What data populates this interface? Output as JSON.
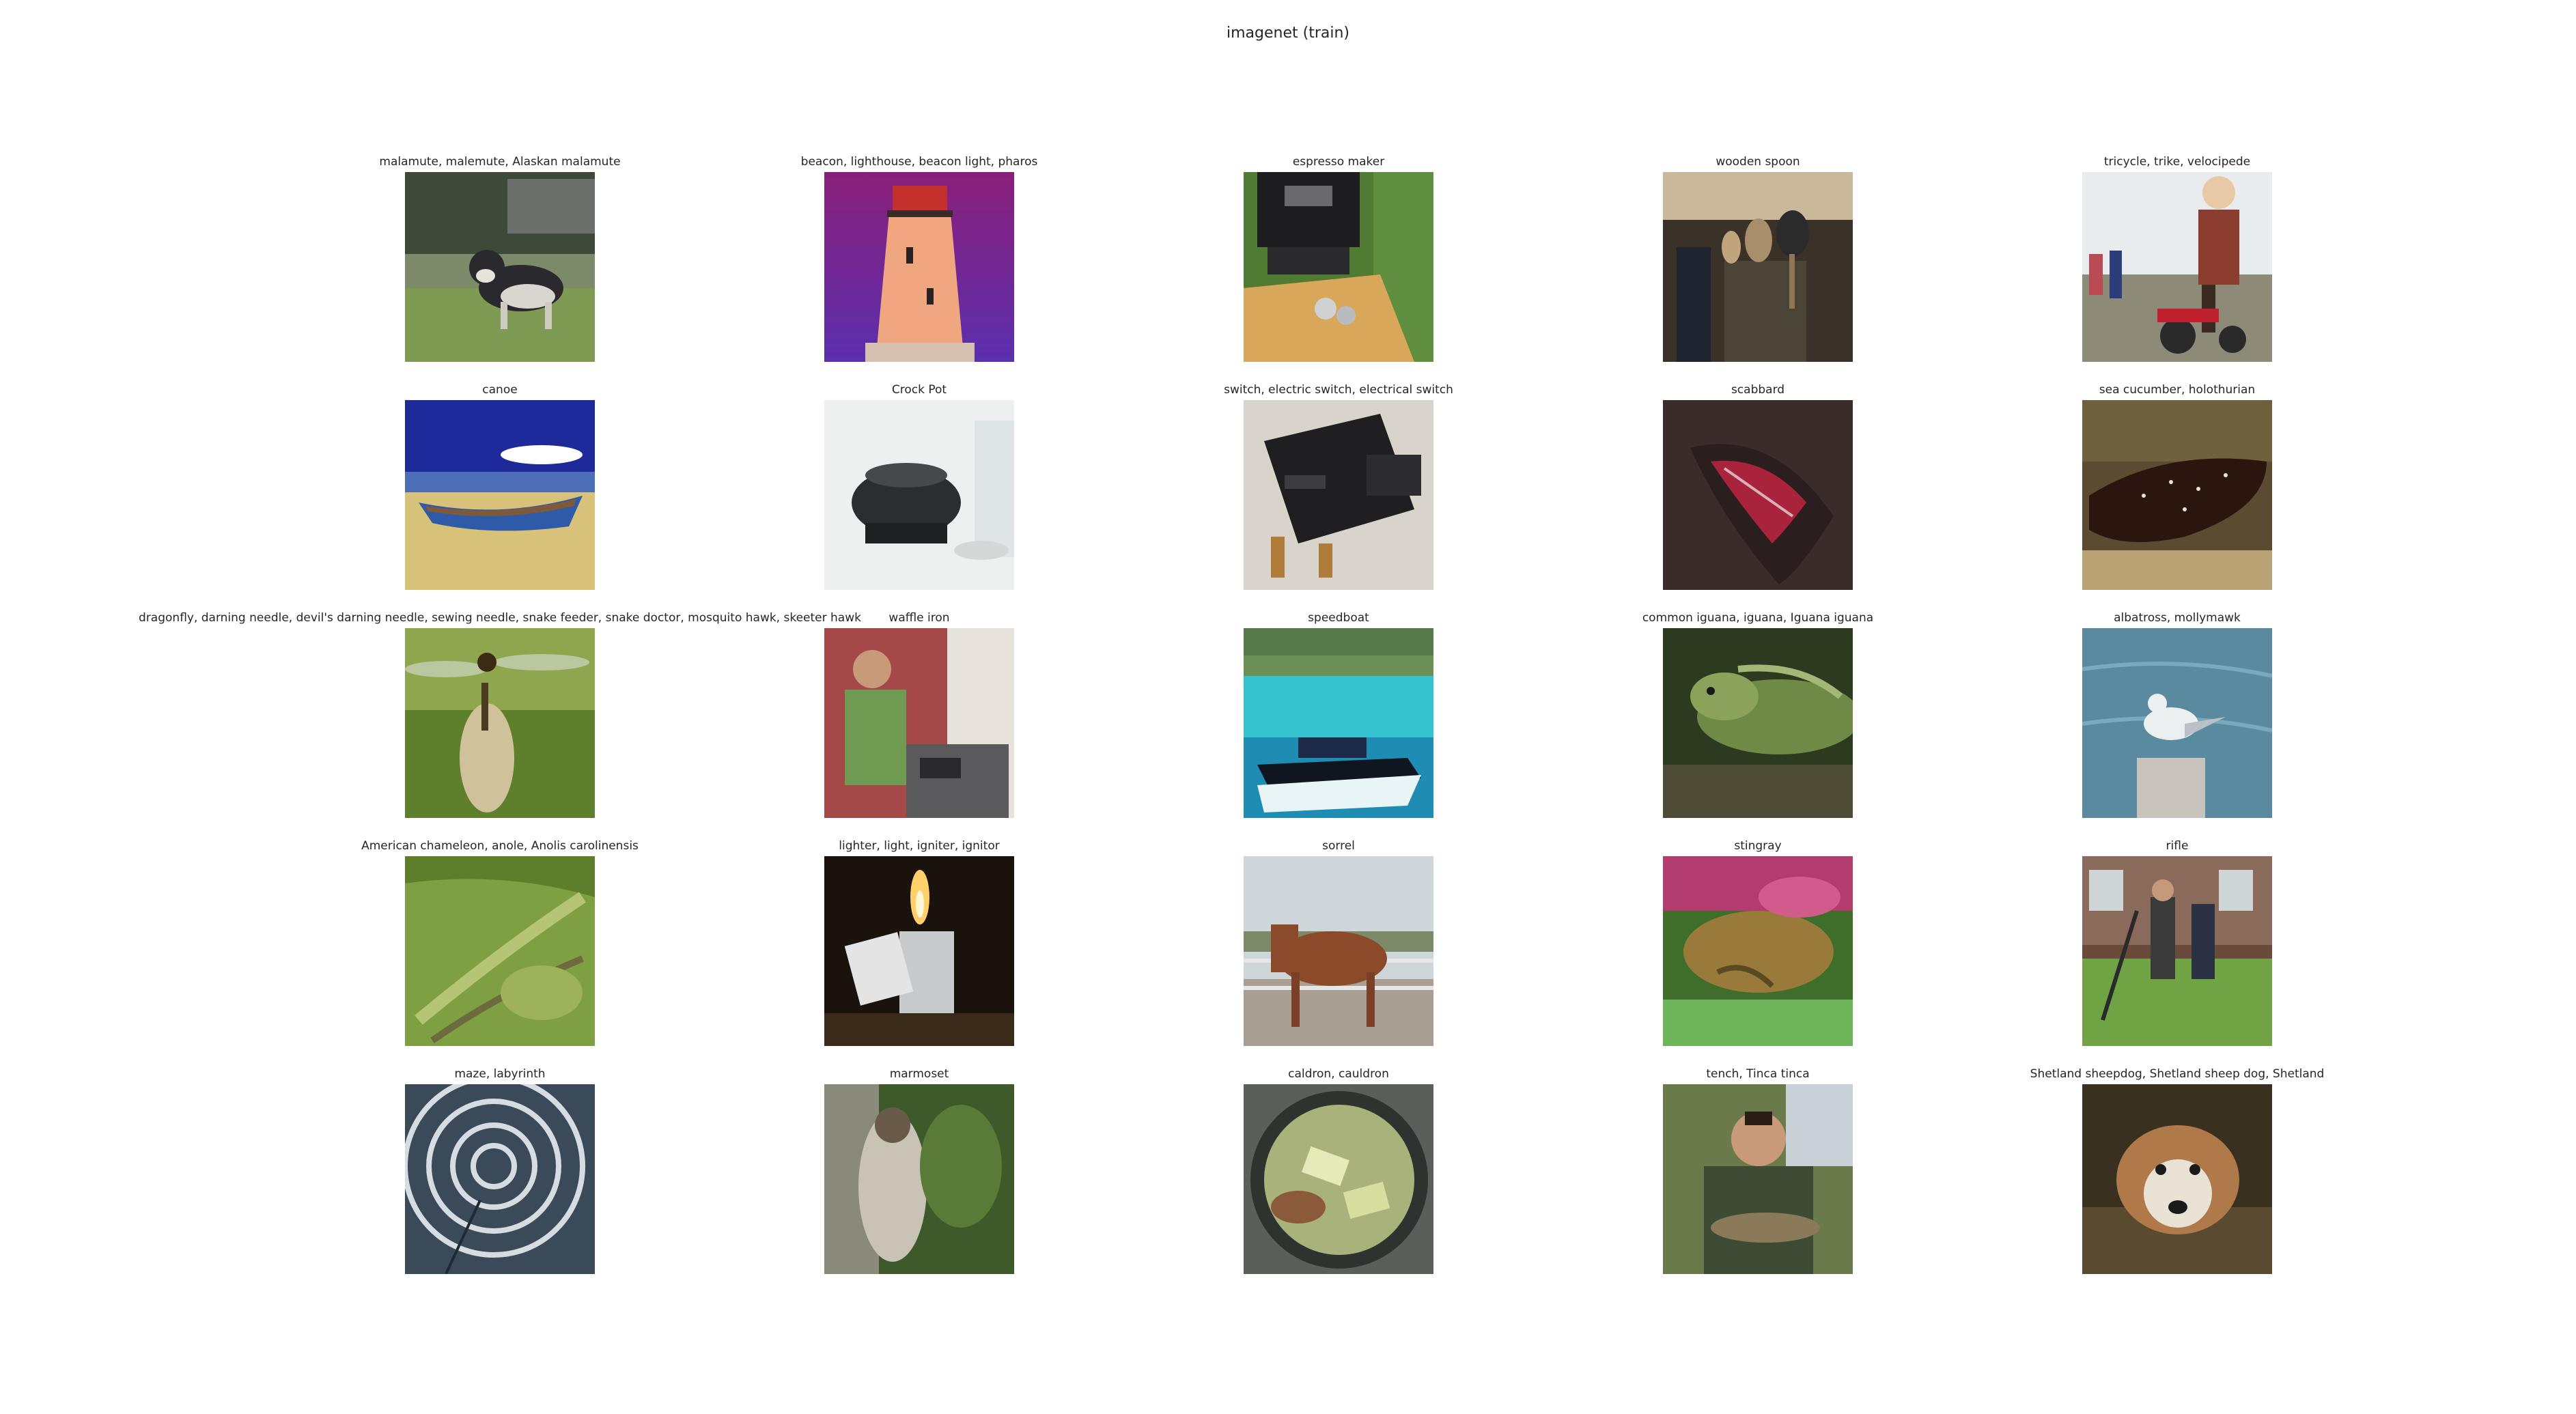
{
  "title": "imagenet (train)",
  "grid": {
    "rows": 5,
    "cols": 5,
    "cells": [
      {
        "label": "malamute, malemute, Alaskan malamute",
        "scene": "dog-yard"
      },
      {
        "label": "beacon, lighthouse, beacon light, pharos",
        "scene": "lighthouse"
      },
      {
        "label": "espresso maker",
        "scene": "espresso"
      },
      {
        "label": "wooden spoon",
        "scene": "spoons"
      },
      {
        "label": "tricycle, trike, velocipede",
        "scene": "tricycle"
      },
      {
        "label": "canoe",
        "scene": "canoe"
      },
      {
        "label": "Crock Pot",
        "scene": "crockpot"
      },
      {
        "label": "switch, electric switch, electrical switch",
        "scene": "switch"
      },
      {
        "label": "scabbard",
        "scene": "scabbard"
      },
      {
        "label": "sea cucumber, holothurian",
        "scene": "seacucumber"
      },
      {
        "label": "dragonfly, darning needle, devil's darning needle, sewing needle, snake feeder, snake doctor, mosquito hawk, skeeter hawk",
        "scene": "dragonfly"
      },
      {
        "label": "waffle iron",
        "scene": "kitchen"
      },
      {
        "label": "speedboat",
        "scene": "speedboat"
      },
      {
        "label": "common iguana, iguana, Iguana iguana",
        "scene": "iguana"
      },
      {
        "label": "albatross, mollymawk",
        "scene": "bird-post"
      },
      {
        "label": "American chameleon, anole, Anolis carolinensis",
        "scene": "anole"
      },
      {
        "label": "lighter, light, igniter, ignitor",
        "scene": "lighter"
      },
      {
        "label": "sorrel",
        "scene": "horse"
      },
      {
        "label": "stingray",
        "scene": "stingray"
      },
      {
        "label": "rifle",
        "scene": "rifle"
      },
      {
        "label": "maze, labyrinth",
        "scene": "maze"
      },
      {
        "label": "marmoset",
        "scene": "marmoset"
      },
      {
        "label": "caldron, cauldron",
        "scene": "cauldron"
      },
      {
        "label": "tench, Tinca tinca",
        "scene": "fisherman"
      },
      {
        "label": "Shetland sheepdog, Shetland sheep dog, Shetland",
        "scene": "sheltie"
      }
    ]
  }
}
